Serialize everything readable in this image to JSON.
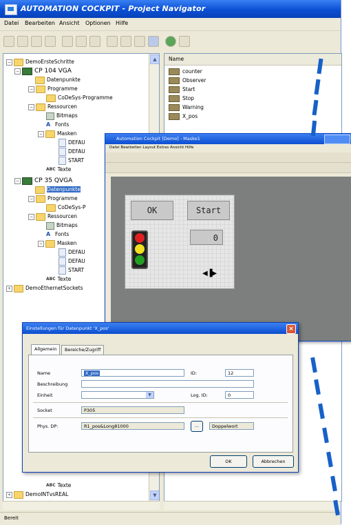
{
  "app": {
    "title": "AUTOMATION COCKPIT - Project Navigator",
    "status": "Bereit"
  },
  "menu": [
    "Datei",
    "Bearbeiten",
    "Ansicht",
    "Optionen",
    "Hilfe"
  ],
  "tree": {
    "root": "DemoErsteSchritte",
    "items": [
      {
        "label": "CP 104 VGA",
        "icon": "plc-icon"
      },
      {
        "label": "Datenpunkte",
        "icon": "folder-icon"
      },
      {
        "label": "Programme",
        "icon": "folder-icon"
      },
      {
        "label": "CoDeSys-Programme",
        "icon": "folder-icon"
      },
      {
        "label": "Ressourcen",
        "icon": "folder-icon"
      },
      {
        "label": "Bitmaps",
        "icon": "bitmap-icon"
      },
      {
        "label": "Fonts",
        "icon": "font-icon"
      },
      {
        "label": "Masken",
        "icon": "folder-icon"
      },
      {
        "label": "DEFAU",
        "icon": "document-icon"
      },
      {
        "label": "DEFAU",
        "icon": "document-icon"
      },
      {
        "label": "START",
        "icon": "document-icon"
      },
      {
        "label": "Texte",
        "icon": "text-icon"
      },
      {
        "label": "CP 35 QVGA",
        "icon": "plc-icon"
      },
      {
        "label": "Datenpunkte",
        "icon": "folder-icon"
      },
      {
        "label": "Programme",
        "icon": "folder-icon"
      },
      {
        "label": "CoDeSys-P",
        "icon": "folder-icon"
      },
      {
        "label": "Ressourcen",
        "icon": "folder-icon"
      },
      {
        "label": "Bitmaps",
        "icon": "bitmap-icon"
      },
      {
        "label": "Fonts",
        "icon": "font-icon"
      },
      {
        "label": "Masken",
        "icon": "folder-icon"
      },
      {
        "label": "DEFAU",
        "icon": "document-icon"
      },
      {
        "label": "DEFAU",
        "icon": "document-icon"
      },
      {
        "label": "START",
        "icon": "document-icon"
      },
      {
        "label": "Texte",
        "icon": "text-icon"
      },
      {
        "label": "DemoEthernetSockets",
        "icon": "folder-icon"
      }
    ],
    "bottom_items": [
      {
        "label": "Texte",
        "icon": "text-icon"
      },
      {
        "label": "DemoINTvsREAL",
        "icon": "folder-icon"
      }
    ]
  },
  "list": {
    "header": "Name",
    "items": [
      "counter",
      "Observer",
      "Start",
      "Stop",
      "Warning",
      "X_pos"
    ]
  },
  "editor": {
    "title": "Automation Cockpit [Demo] - Maske1",
    "menu": "Datei  Bearbeiten  Layout  Extras  Ansicht  Hilfe",
    "ok_label": "OK",
    "start_label": "Start",
    "counter_value": "0"
  },
  "dialog": {
    "title": "Einstellungen für Datenpunkt 'X_pos'",
    "tabs": [
      "Allgemein",
      "Bereiche/Zugriff"
    ],
    "name_label": "Name",
    "name_value": "X_pos",
    "id_label": "ID:",
    "id_value": "12",
    "beschreibung_label": "Beschreibung",
    "einheit_label": "Einheit",
    "logid_label": "Log. ID:",
    "logid_value": "0",
    "socket_label": "Socket",
    "socket_value": "P305",
    "phys_label": "Phys. DP:",
    "phys_value": "R1_pos&Long81000",
    "browse_label": "...",
    "type_value": "Doppelwort",
    "ok_label": "OK",
    "cancel_label": "Abbrechen"
  }
}
